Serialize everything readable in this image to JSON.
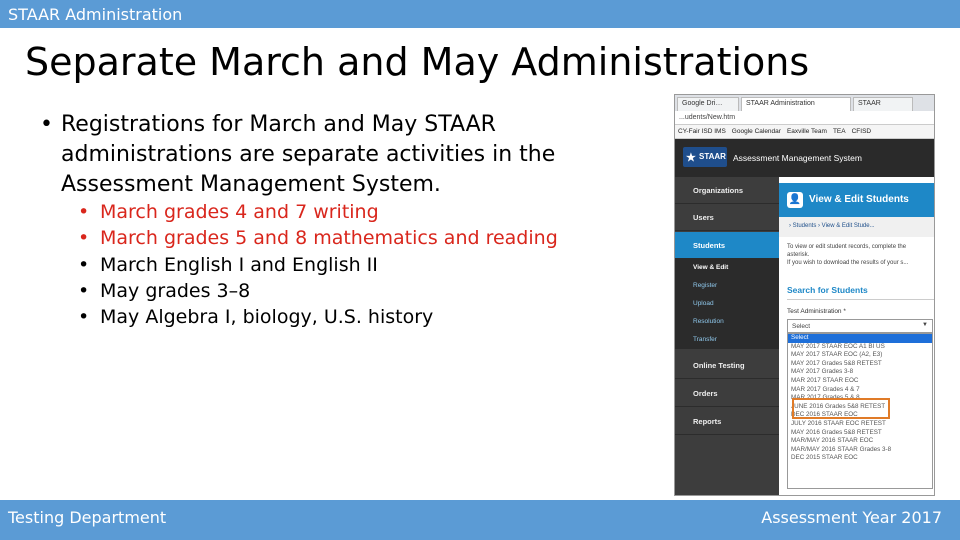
{
  "header": {
    "label": "STAAR Administration"
  },
  "slide": {
    "title": "Separate March and May Administrations",
    "main_bullet": "Registrations for March and May STAAR administrations are separate activities in the Assessment Management System.",
    "sub_bullets": [
      {
        "text": "March grades 4 and 7 writing",
        "color": "#d9261c"
      },
      {
        "text": "March grades 5 and 8 mathematics and reading",
        "color": "#d9261c"
      },
      {
        "text": "March English I and English II",
        "color": "#000000"
      },
      {
        "text": "May grades 3–8",
        "color": "#000000"
      },
      {
        "text": "May Algebra I, biology, U.S. history",
        "color": "#000000"
      }
    ]
  },
  "footer": {
    "left": "Testing Department",
    "right": "Assessment Year 2017"
  },
  "screenshot": {
    "tabs": [
      "Google Dri…",
      "STAAR Administration",
      "STAAR"
    ],
    "url": "...udents/New.htm",
    "bookmarks": [
      "CY-Fair ISD IMS",
      "Google Calendar",
      "Eaxville Team",
      "TEA",
      "CFISD"
    ],
    "app_logo": "STAAR",
    "app_title": "Assessment Management System",
    "sidebar": {
      "organizations": "Organizations",
      "users": "Users",
      "students": "Students",
      "students_sub": [
        "View & Edit",
        "Register",
        "Upload",
        "Resolution",
        "Transfer"
      ],
      "online_testing": "Online Testing",
      "orders": "Orders",
      "reports": "Reports"
    },
    "content": {
      "heading": "View & Edit Students",
      "breadcrumb": "›  Students  ›  View & Edit Stude...",
      "intro_line1": "To view or edit student records, complete the",
      "intro_line2": "asterisk.",
      "intro_line3": "If you wish to download the results of your s...",
      "search_heading": "Search for Students",
      "test_admin_label": "Test Administration *",
      "select_value": "Select",
      "options": [
        "Select",
        "MAY 2017 STAAR EOC A1 BI US",
        "MAY 2017 STAAR EOC (A2, E3)",
        "MAY 2017 Grades 5&8 RETEST",
        "MAY 2017 Grades 3-8",
        "MAR 2017 STAAR EOC",
        "MAR 2017 Grades 4 & 7",
        "MAR 2017 Grades 5 & 8",
        "JUNE 2016 Grades 5&8 RETEST",
        "DEC 2016 STAAR EOC",
        "JULY 2016 STAAR EOC RETEST",
        "MAY 2016 Grades 5&8 RETEST",
        "MAR/MAY 2016 STAAR EOC",
        "MAR/MAY 2016 STAAR Grades 3-8",
        "DEC 2015 STAAR EOC"
      ]
    }
  }
}
